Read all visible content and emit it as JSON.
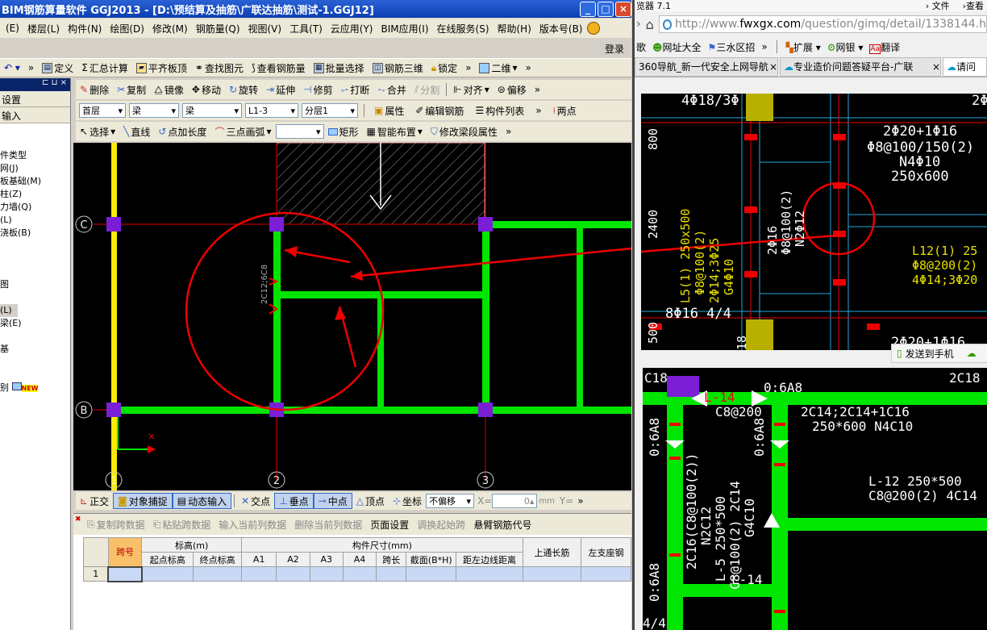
{
  "titlebar": {
    "title": "BIM钢筋算量软件 GGJ2013 - [D:\\预结算及抽筋\\广联达抽筋\\测试-1.GGJ12]",
    "min": "_",
    "max": "□",
    "close": "×"
  },
  "menu": [
    "(E)",
    "楼层(L)",
    "构件(N)",
    "绘图(D)",
    "修改(M)",
    "钢筋量(Q)",
    "视图(V)",
    "工具(T)",
    "云应用(Y)",
    "BIM应用(I)",
    "在线服务(S)",
    "帮助(H)",
    "版本号(B)"
  ],
  "login": "登录",
  "toolbar1": {
    "define": "定义",
    "sum": "汇总计算",
    "slab_top": "平齐板顶",
    "find": "查找图元",
    "view_rebar": "查看钢筋量",
    "batch": "批量选择",
    "rebar3d": "钢筋三维",
    "lock": "锁定",
    "view_mode": "二维"
  },
  "toolbar2": {
    "delete": "删除",
    "copy": "复制",
    "mirror": "镜像",
    "move": "移动",
    "rotate": "旋转",
    "extend": "延伸",
    "trim": "修剪",
    "break": "打断",
    "merge": "合并",
    "split": "分割",
    "align": "对齐",
    "offset": "偏移"
  },
  "toolbar3": {
    "floor": "首层",
    "type1": "梁",
    "type2": "梁",
    "name": "L1-3",
    "layer": "分层1",
    "props": "属性",
    "edit_rebar": "编辑钢筋",
    "comp_list": "构件列表",
    "two_points": "两点"
  },
  "toolbar4": {
    "select": "选择",
    "line": "直线",
    "point_len": "点加长度",
    "arc": "三点画弧",
    "rect": "矩形",
    "smart": "智能布置",
    "modify_span": "修改梁段属性"
  },
  "left_panel": {
    "row1": "设置",
    "row2": "输入",
    "items": [
      "件类型",
      "网(J)",
      "板基础(M)",
      "柱(Z)",
      "力墙(Q)",
      "(L)",
      "浇板(B)",
      "",
      "",
      "",
      "",
      "",
      "图",
      "",
      "(L)",
      "梁(E)",
      "",
      "",
      "基",
      "",
      "",
      "别"
    ],
    "new_badge": "NEW"
  },
  "cad": {
    "axis_c": "C",
    "axis_b": "B",
    "axis_1": "1",
    "axis_2": "2",
    "axis_3": "3",
    "beam_label": "2C12;6C8"
  },
  "snapbar": {
    "ortho": "正交",
    "obj_snap": "对象捕捉",
    "dyn_input": "动态输入",
    "intersect": "交点",
    "perp": "垂点",
    "mid": "中点",
    "vertex": "顶点",
    "coord": "坐标",
    "offset_mode": "不偏移",
    "x_label": "X=",
    "x_value": "0",
    "unit": "mm",
    "y_label": "Y="
  },
  "grid_toolbar": {
    "copy_span": "复制跨数据",
    "paste_span": "粘贴跨数据",
    "input_col": "输入当前列数据",
    "del_col": "删除当前列数据",
    "page_setup": "页面设置",
    "swap_start": "调换起始跨",
    "cantilever": "悬臂钢筋代号"
  },
  "table": {
    "span": "跨号",
    "elev": "标高(m)",
    "start_elev": "起点标高",
    "end_elev": "终点标高",
    "dims": "构件尺寸(mm)",
    "a1": "A1",
    "a2": "A2",
    "a3": "A3",
    "a4": "A4",
    "span_len": "跨长",
    "section": "截面(B*H)",
    "edge_dist": "距左边线距离",
    "top_long": "上通长筋",
    "left_seat": "左支座钢",
    "row1": "1"
  },
  "browser": {
    "title": "览器 7.1",
    "file": "文件",
    "view": "查看",
    "url_prefix": "http://www.",
    "url_host": "fwxgx.com",
    "url_path": "/question/gimq/detail/1338144.h",
    "fav1": "歌",
    "fav2": "网址大全",
    "fav3": "三水区招",
    "ext": "扩展",
    "netbank": "网银",
    "translate": "翻译",
    "tab1": "360导航_新一代安全上网导航",
    "tab2": "专业造价问题答疑平台-广联",
    "tab3": "请问",
    "send_phone": "发送到手机"
  },
  "drawing_top": {
    "t1": "4Φ18/3Φ",
    "t2": "2Φ20+1Φ16",
    "t3": "Φ8@100/150(2)",
    "t4": "N4Φ10",
    "t5": "250x600",
    "t6": "L5(1) 250x500",
    "t7": "Φ8@100(2)",
    "t8": "2Φ14;3Φ25",
    "t9": "G4Φ10",
    "t10": "2Φ16",
    "t11": "Φ8@100(2)",
    "t12": "N2Φ12",
    "t13": "L12(1) 25",
    "t14": "Φ8@200(2)",
    "t15": "4Φ14;3Φ20",
    "t16": "8Φ16 4/4",
    "t17": "2400",
    "t18": "800",
    "t19": "500",
    "t20": "2Φ20+1Φ16",
    "t21": "18",
    "t22": "2Φ"
  },
  "drawing_bottom": {
    "b1": "C18",
    "b2": "0:6A8",
    "b3": "2C18",
    "b4": "L-14",
    "b5": "C8@200",
    "b6": "2C14;2C14+1C16",
    "b7": "250*600 N4C10",
    "b8": "L-12 250*500",
    "b9": "C8@200(2) 4C14",
    "b10": "L-5 250*500",
    "b11": "C8@100(2) 2C14",
    "b12": "G4C10",
    "b13": "2C16(C8@100(2))",
    "b14": "N2C12",
    "b15": "L-14",
    "b16": "0:6A8",
    "b17": "0:6A8",
    "b18": "4/4",
    "b19": "0:6A8"
  },
  "colors": {
    "green": "#00e600",
    "red": "#e00000",
    "purple": "#7a1fd6",
    "yellow": "#ffeb00",
    "cad_bg": "#000000"
  }
}
